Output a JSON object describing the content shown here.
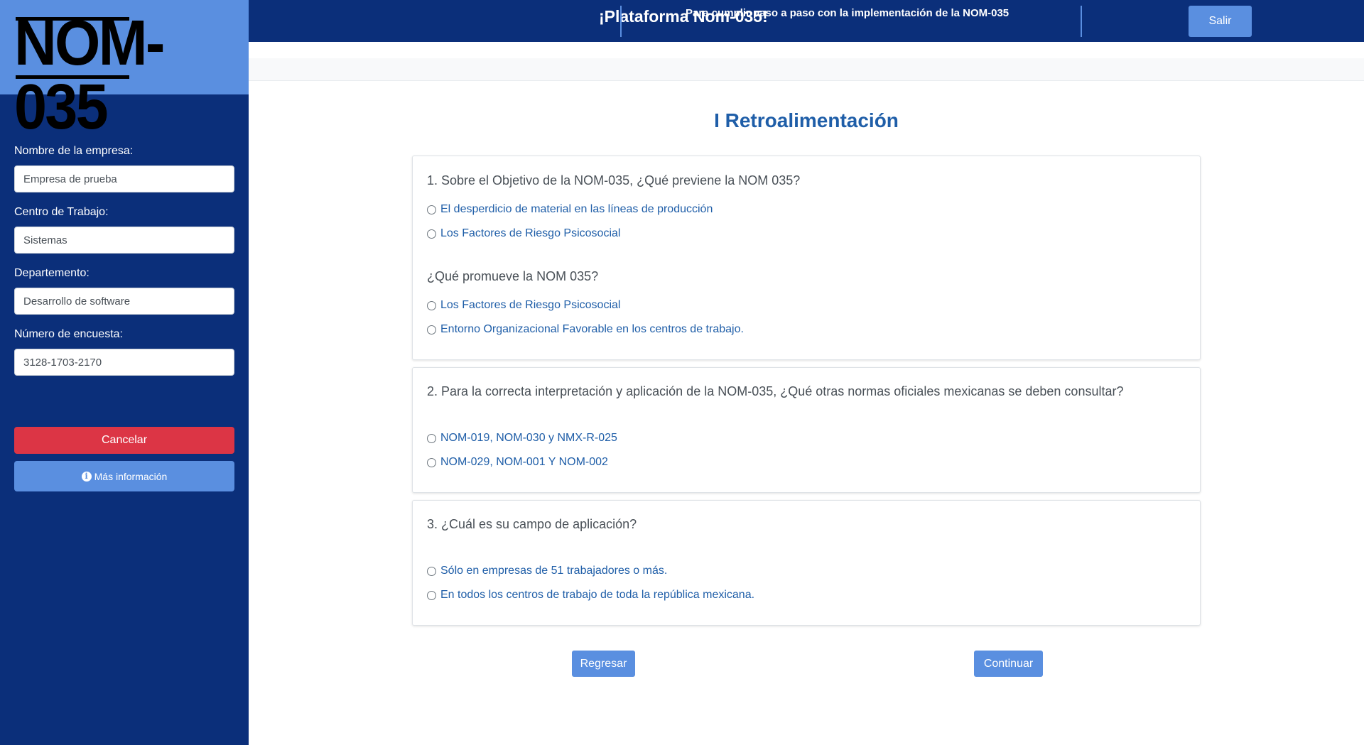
{
  "logo": {
    "text": "NOM-035"
  },
  "sidebar": {
    "fields": [
      {
        "label": "Nombre de la empresa:",
        "value": "Empresa de prueba"
      },
      {
        "label": "Centro de Trabajo:",
        "value": "Sistemas"
      },
      {
        "label": "Departemento:",
        "value": "Desarrollo de software"
      },
      {
        "label": "Número de encuesta:",
        "value": "3128-1703-2170"
      }
    ],
    "cancel_label": "Cancelar",
    "info_label": "Más información",
    "info_icon": "info-circle-icon"
  },
  "header": {
    "title": "¡Plataforma Nom-035!",
    "subtitle": "Para cumplir paso a paso con la implementación de la NOM-035",
    "exit_label": "Salir"
  },
  "main": {
    "title": "I Retroalimentación",
    "questions": [
      {
        "text": "1. Sobre el Objetivo de la NOM-035, ¿Qué previene la NOM 035?",
        "options": [
          "El desperdicio de material en las líneas de producción",
          "Los Factores de Riesgo Psicosocial"
        ]
      },
      {
        "text": "¿Qué promueve la NOM 035?",
        "options": [
          "Los Factores de Riesgo Psicosocial",
          "Entorno Organizacional Favorable en los centros de trabajo."
        ]
      },
      {
        "text": "2. Para la correcta interpretación y aplicación de la NOM-035, ¿Qué otras normas oficiales mexicanas se deben consultar?",
        "options": [
          "NOM-019, NOM-030 y NMX-R-025",
          "NOM-029, NOM-001 Y NOM-002"
        ]
      },
      {
        "text": "3. ¿Cuál es su campo de aplicación?",
        "options": [
          "Sólo en empresas de 51 trabajadores o más.",
          "En todos los centros de trabajo de toda la república mexicana."
        ]
      }
    ],
    "back_label": "Regresar",
    "continue_label": "Continuar"
  },
  "colors": {
    "sidebar_bg": "#0b2f7a",
    "accent": "#5a8fe0",
    "danger": "#dc3545",
    "link": "#1f5ea8"
  }
}
